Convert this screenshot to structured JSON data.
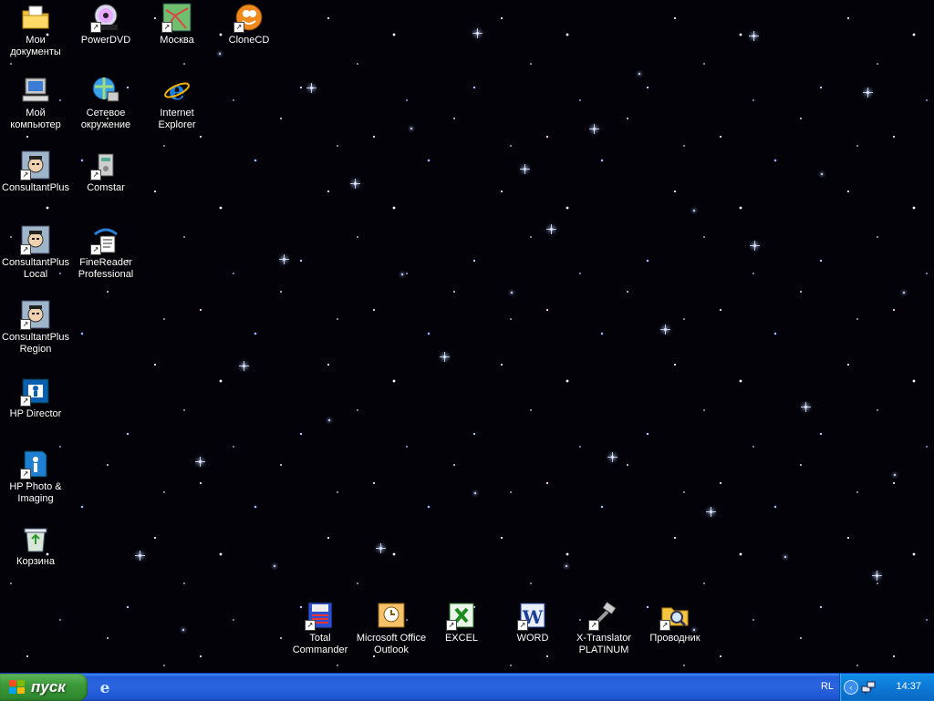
{
  "desktop": {
    "icons_left_column": [
      {
        "label": "Мои документы",
        "icon": "folder-documents-icon"
      },
      {
        "label": "Мой компьютер",
        "icon": "my-computer-icon"
      },
      {
        "label": "ConsultantPlus",
        "icon": "consultantplus-icon"
      },
      {
        "label": "ConsultantPlus Local",
        "icon": "consultantplus-icon"
      },
      {
        "label": "ConsultantPlus Region",
        "icon": "consultantplus-icon"
      },
      {
        "label": "HP Director",
        "icon": "hp-director-icon"
      },
      {
        "label": "HP Photo & Imaging",
        "icon": "hp-photo-icon"
      },
      {
        "label": "Корзина",
        "icon": "recycle-bin-icon"
      }
    ],
    "icons_second_column": [
      {
        "label": "PowerDVD",
        "icon": "powerdvd-icon"
      },
      {
        "label": "Сетевое окружение",
        "icon": "network-places-icon"
      },
      {
        "label": "Comstar",
        "icon": "comstar-icon"
      },
      {
        "label": "FineReader Professional",
        "icon": "finereader-icon"
      }
    ],
    "icons_third_column": [
      {
        "label": "Москва",
        "icon": "moscow-map-icon"
      },
      {
        "label": "Internet Explorer",
        "icon": "internet-explorer-icon"
      }
    ],
    "icons_fourth_column": [
      {
        "label": "CloneCD",
        "icon": "clonecd-icon"
      }
    ],
    "icons_bottom_row": [
      {
        "label": "Total Commander",
        "icon": "total-commander-icon"
      },
      {
        "label": "Microsoft Office Outlook",
        "icon": "outlook-icon"
      },
      {
        "label": "EXCEL",
        "icon": "excel-icon"
      },
      {
        "label": "WORD",
        "icon": "word-icon"
      },
      {
        "label": "X-Translator PLATINUM",
        "icon": "x-translator-icon"
      },
      {
        "label": "Проводник",
        "icon": "explorer-icon"
      }
    ]
  },
  "taskbar": {
    "start_label": "пуск",
    "quick_launch": [
      {
        "icon": "internet-explorer-icon"
      }
    ],
    "language": "RL",
    "clock": "14:37",
    "colors": {
      "taskbar": "#245edb",
      "start": "#3c9a3a",
      "tray": "#0c79d6"
    }
  }
}
